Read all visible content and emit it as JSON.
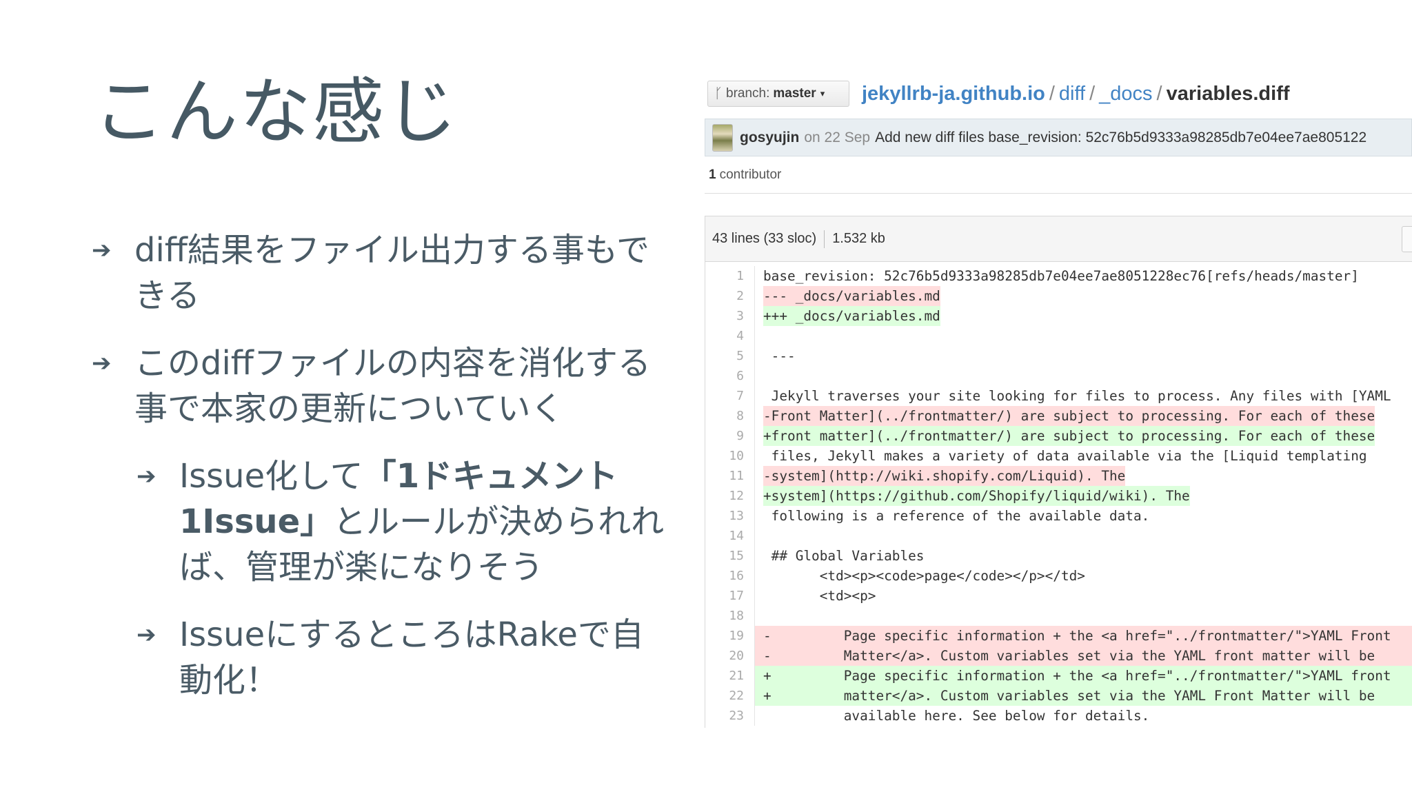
{
  "slide": {
    "title": "こんな感じ",
    "bullets": [
      {
        "level": 1,
        "text": "diff結果をファイル出力する事もできる"
      },
      {
        "level": 1,
        "text": "このdiffファイルの内容を消化する事で本家の更新についていく"
      },
      {
        "level": 2,
        "text_prefix": "Issue化して",
        "text_bold": "「1ドキュメント1Issue」",
        "text_suffix": "とルールが決められれば、管理が楽になりそう"
      },
      {
        "level": 2,
        "text": "IssueにするところはRakeで自動化！"
      }
    ]
  },
  "github": {
    "branch_label": "branch:",
    "branch_name": "master",
    "breadcrumb": {
      "repo": "jekyllrb-ja.github.io",
      "dir1": "diff",
      "dir2": "_docs",
      "file": "variables.diff",
      "separator": "/"
    },
    "commit": {
      "author": "gosyujin",
      "date": "on 22 Sep",
      "message": "Add new diff files base_revision: 52c76b5d9333a98285db7e04ee7ae805122"
    },
    "contributors": {
      "count": "1",
      "label": "contributor"
    },
    "file_info": {
      "lines": "43 lines (33 sloc)",
      "size": "1.532 kb"
    },
    "code_lines": [
      {
        "n": "1",
        "type": "ctx",
        "text": "base_revision: 52c76b5d9333a98285db7e04ee7ae8051228ec76[refs/heads/master]"
      },
      {
        "n": "2",
        "type": "del",
        "text": "--- _docs/variables.md"
      },
      {
        "n": "3",
        "type": "add",
        "text": "+++ _docs/variables.md"
      },
      {
        "n": "4",
        "type": "ctx",
        "text": ""
      },
      {
        "n": "5",
        "type": "ctx",
        "text": " ---"
      },
      {
        "n": "6",
        "type": "ctx",
        "text": ""
      },
      {
        "n": "7",
        "type": "ctx",
        "text": " Jekyll traverses your site looking for files to process. Any files with [YAML"
      },
      {
        "n": "8",
        "type": "del",
        "text": "-Front Matter](../frontmatter/) are subject to processing. For each of these"
      },
      {
        "n": "9",
        "type": "add",
        "text": "+front matter](../frontmatter/) are subject to processing. For each of these"
      },
      {
        "n": "10",
        "type": "ctx",
        "text": " files, Jekyll makes a variety of data available via the [Liquid templating"
      },
      {
        "n": "11",
        "type": "del",
        "text": "-system](http://wiki.shopify.com/Liquid). The"
      },
      {
        "n": "12",
        "type": "add",
        "text": "+system](https://github.com/Shopify/liquid/wiki). The"
      },
      {
        "n": "13",
        "type": "ctx",
        "text": " following is a reference of the available data."
      },
      {
        "n": "14",
        "type": "ctx",
        "text": ""
      },
      {
        "n": "15",
        "type": "ctx",
        "text": " ## Global Variables"
      },
      {
        "n": "16",
        "type": "ctx",
        "text": "       <td><p><code>page</code></p></td>"
      },
      {
        "n": "17",
        "type": "ctx",
        "text": "       <td><p>"
      },
      {
        "n": "18",
        "type": "ctx",
        "text": ""
      },
      {
        "n": "19",
        "type": "del-full",
        "text": "-         Page specific information + the <a href=\"../frontmatter/\">YAML Front"
      },
      {
        "n": "20",
        "type": "del-full",
        "text": "-         Matter</a>. Custom variables set via the YAML front matter will be"
      },
      {
        "n": "21",
        "type": "add-full",
        "text": "+         Page specific information + the <a href=\"../frontmatter/\">YAML front"
      },
      {
        "n": "22",
        "type": "add-full",
        "text": "+         matter</a>. Custom variables set via the YAML Front Matter will be"
      },
      {
        "n": "23",
        "type": "ctx",
        "text": "          available here. See below for details."
      }
    ]
  }
}
